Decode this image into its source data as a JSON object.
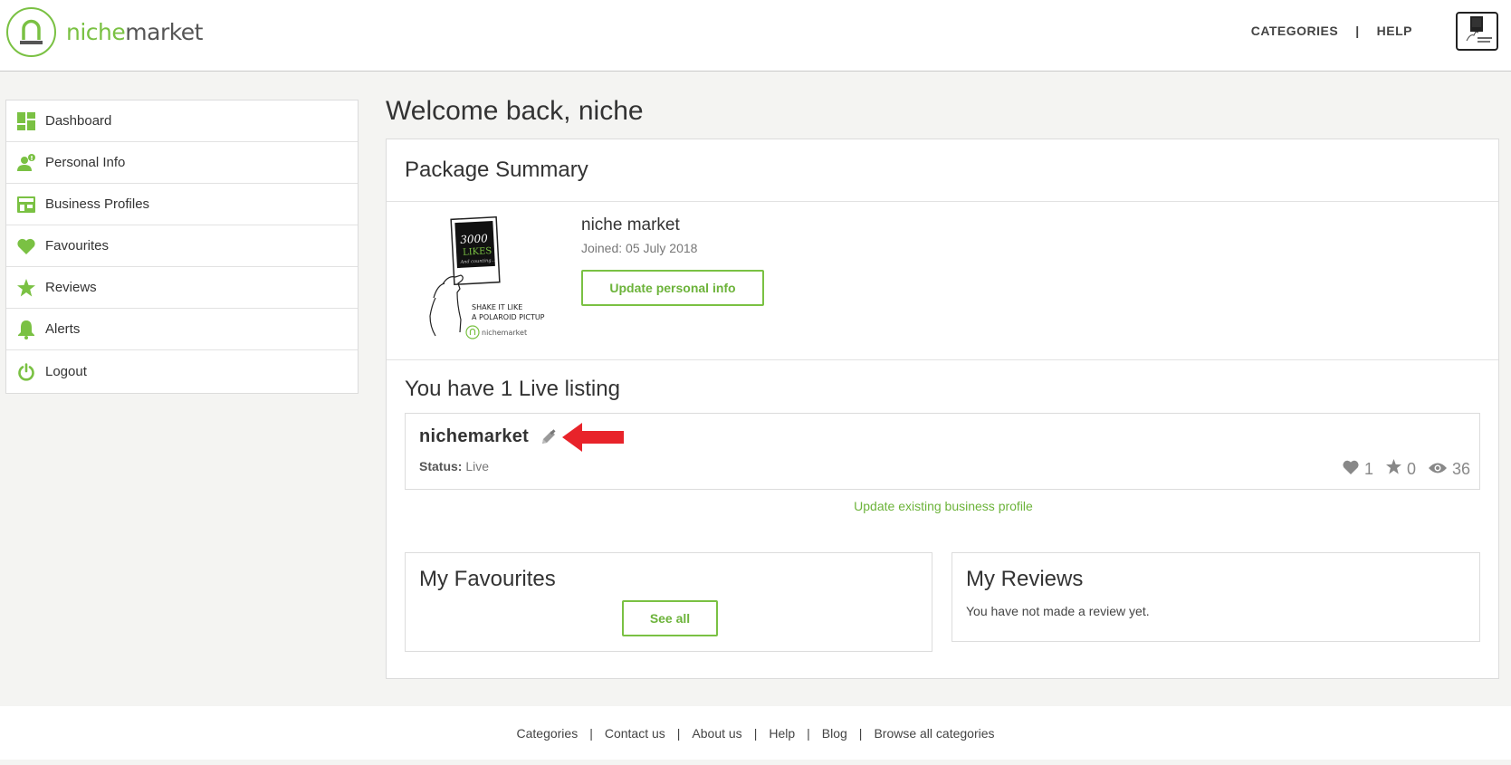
{
  "header": {
    "logo": {
      "text_part1": "niche",
      "text_part2": "market"
    },
    "nav": [
      {
        "label": "CATEGORIES"
      },
      {
        "label": "HELP"
      }
    ],
    "nav_separator": "|"
  },
  "sidebar": {
    "items": [
      {
        "label": "Dashboard",
        "icon": "dashboard-icon"
      },
      {
        "label": "Personal Info",
        "icon": "user-info-icon"
      },
      {
        "label": "Business Profiles",
        "icon": "store-icon"
      },
      {
        "label": "Favourites",
        "icon": "heart-icon"
      },
      {
        "label": "Reviews",
        "icon": "star-icon"
      },
      {
        "label": "Alerts",
        "icon": "bell-icon"
      },
      {
        "label": "Logout",
        "icon": "power-icon"
      }
    ]
  },
  "main": {
    "welcome": "Welcome back, niche",
    "package_summary": {
      "title": "Package Summary",
      "image_text": {
        "likes_count": "3000",
        "likes_word": "LIKES",
        "counting": "And counting...",
        "caption_line1": "SHAKE IT LIKE",
        "caption_line2": "A POLAROID PICTUP",
        "brand": "nichemarket"
      },
      "name": "niche market",
      "joined": "Joined: 05 July 2018",
      "update_button": "Update personal info"
    },
    "live": {
      "title": "You have 1 Live listing",
      "listing": {
        "name": "nichemarket",
        "status_label": "Status:",
        "status_value": "Live",
        "favourites": "1",
        "reviews": "0",
        "views": "36"
      },
      "update_link": "Update existing business profile"
    },
    "favourites": {
      "title": "My Favourites",
      "button": "See all"
    },
    "reviews": {
      "title": "My Reviews",
      "empty_text": "You have not made a review yet."
    }
  },
  "footer": {
    "links": [
      {
        "label": "Categories"
      },
      {
        "label": "Contact us"
      },
      {
        "label": "About us"
      },
      {
        "label": "Help"
      },
      {
        "label": "Blog"
      },
      {
        "label": "Browse all categories"
      }
    ],
    "separator": "|"
  },
  "colors": {
    "accent": "#7ac143",
    "arrow": "#e8232a",
    "background": "#f4f4f2"
  }
}
